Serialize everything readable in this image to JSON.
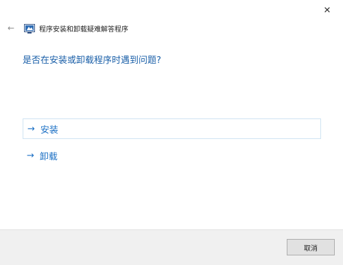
{
  "window": {
    "title": "程序安装和卸载疑难解答程序",
    "close_glyph": "✕",
    "back_glyph": "←"
  },
  "main": {
    "question": "是否在安装或卸载程序时遇到问题?",
    "options": [
      {
        "arrow": "→",
        "label": "安装"
      },
      {
        "arrow": "→",
        "label": "卸载"
      }
    ]
  },
  "footer": {
    "cancel_label": "取消"
  },
  "colors": {
    "question": "#1a5fa8",
    "link": "#1a6fc4",
    "focus_border": "#cfe3f2",
    "footer_bg": "#f0f0f0"
  },
  "icons": [
    "close-icon",
    "back-arrow-icon",
    "troubleshooter-app-icon",
    "right-arrow-icon"
  ]
}
